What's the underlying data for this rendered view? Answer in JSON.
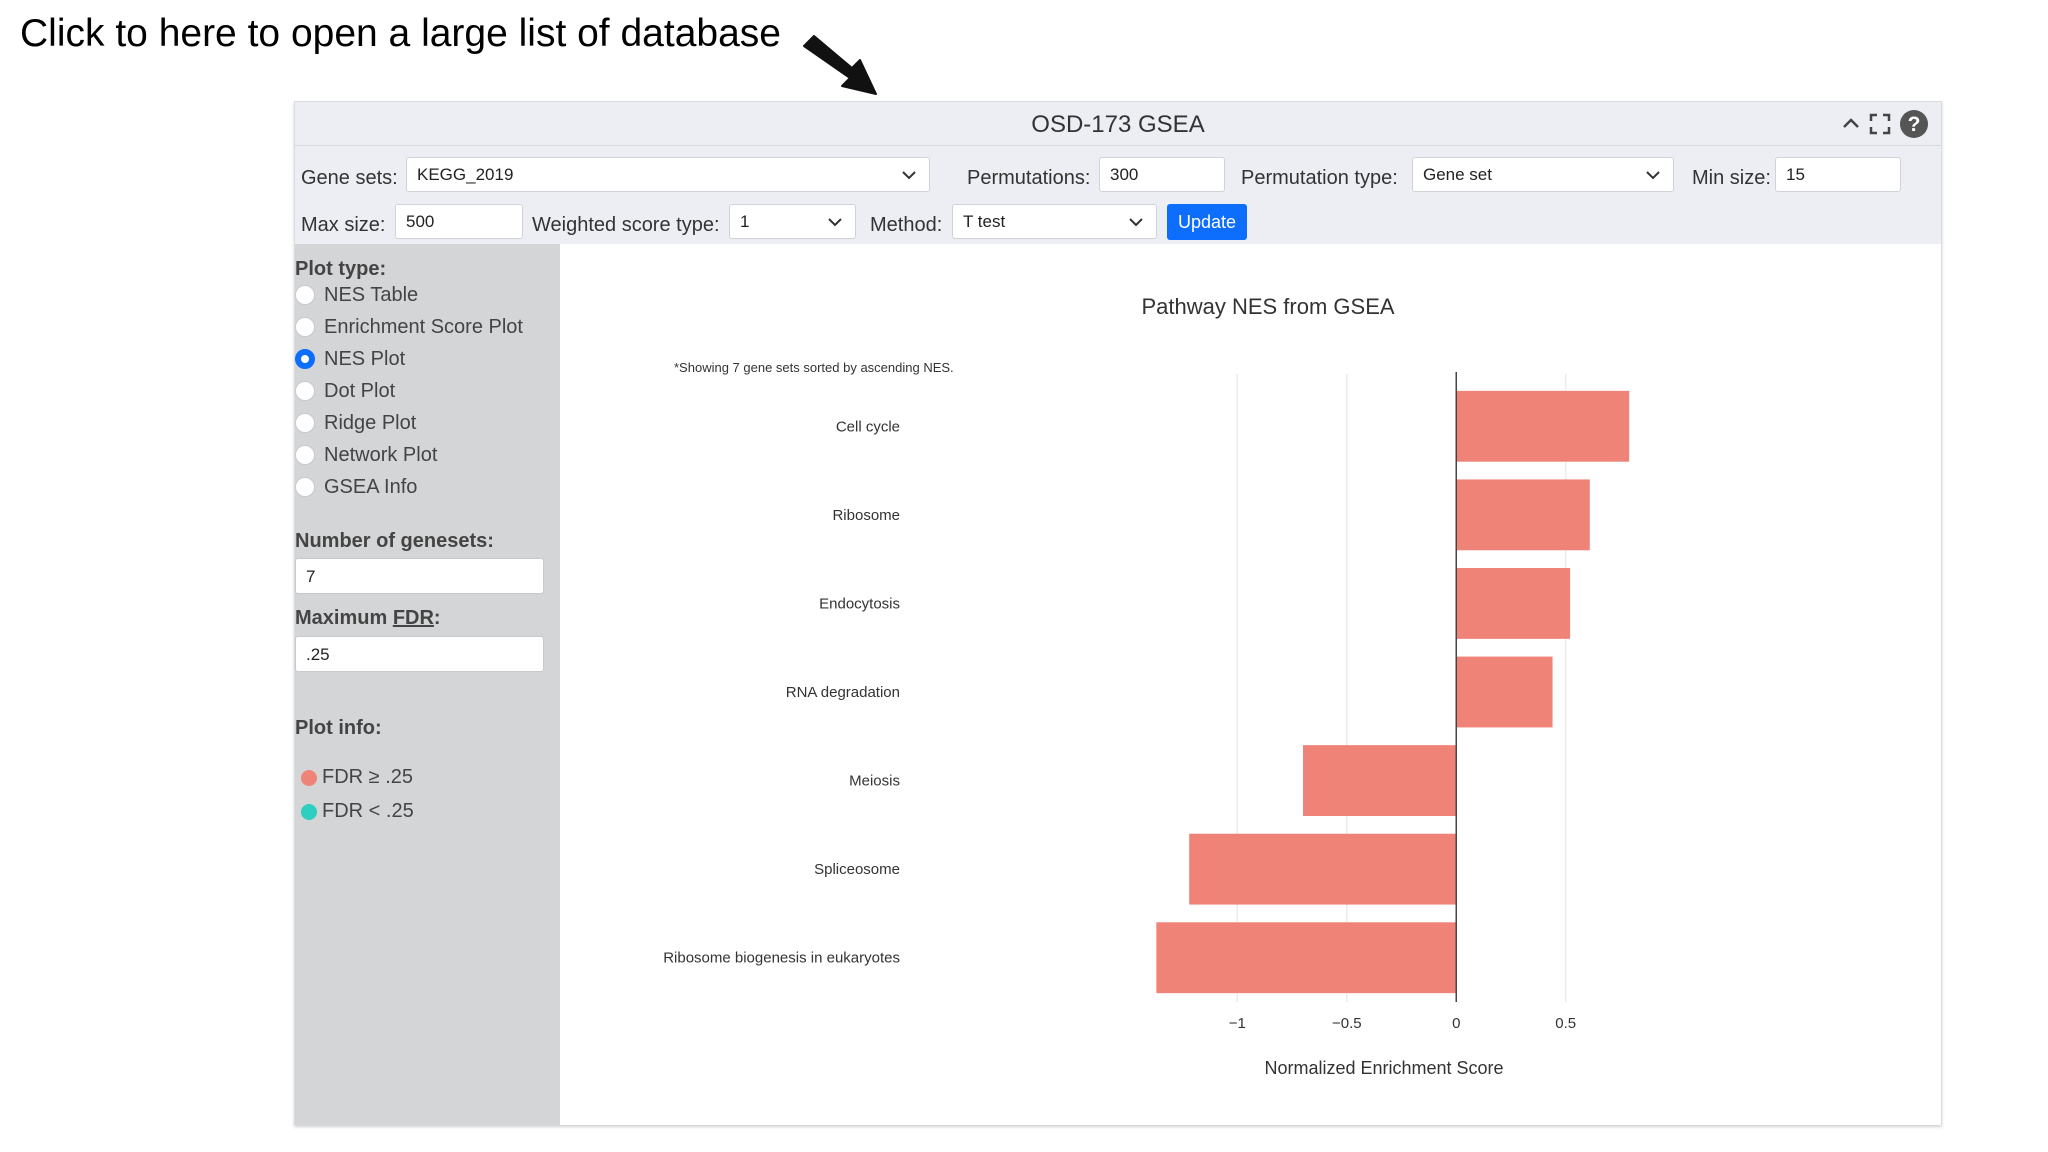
{
  "annotation": {
    "text": "Click to here to open a large list of database"
  },
  "panel": {
    "title": "OSD-173 GSEA",
    "icons": [
      "chevron-up-icon",
      "fullscreen-icon",
      "help-icon"
    ]
  },
  "controls": {
    "gene_sets_label": "Gene sets:",
    "gene_sets_value": "KEGG_2019",
    "permutations_label": "Permutations:",
    "permutations_value": "300",
    "permutation_type_label": "Permutation type:",
    "permutation_type_value": "Gene set",
    "min_size_label": "Min size:",
    "min_size_value": "15",
    "max_size_label": "Max size:",
    "max_size_value": "500",
    "weighted_label": "Weighted score type:",
    "weighted_value": "1",
    "method_label": "Method:",
    "method_value": "T test",
    "update_label": "Update"
  },
  "sidebar": {
    "plot_type_heading": "Plot type:",
    "plot_types": [
      {
        "label": "NES Table",
        "checked": false
      },
      {
        "label": "Enrichment Score Plot",
        "checked": false
      },
      {
        "label": "NES Plot",
        "checked": true
      },
      {
        "label": "Dot Plot",
        "checked": false
      },
      {
        "label": "Ridge Plot",
        "checked": false
      },
      {
        "label": "Network Plot",
        "checked": false
      },
      {
        "label": "GSEA Info",
        "checked": false
      }
    ],
    "num_genesets_label": "Number of genesets:",
    "num_genesets_value": "7",
    "max_fdr_prefix": "Maximum ",
    "max_fdr_abbr": "FDR",
    "max_fdr_suffix": ":",
    "max_fdr_value": ".25",
    "plot_info_heading": "Plot info:",
    "legend": [
      {
        "label": "FDR ≥ .25",
        "color": "#f08378"
      },
      {
        "label": "FDR < .25",
        "color": "#2ccfc0"
      }
    ]
  },
  "colors": {
    "accent": "#0d6efd",
    "bar": "#f08378",
    "panel_bg": "#eceef4",
    "sidebar_bg": "#d4d5d7"
  },
  "chart_data": {
    "type": "bar",
    "orientation": "horizontal",
    "title": "Pathway NES from GSEA",
    "note": "*Showing 7 gene sets sorted by ascending NES.",
    "xlabel": "Normalized Enrichment Score",
    "ylabel": "",
    "xlim": [
      -1.6,
      1.15
    ],
    "xticks": [
      -1,
      -0.5,
      0,
      0.5
    ],
    "xtick_labels": [
      "−1",
      "−0.5",
      "0",
      "0.5"
    ],
    "grid": true,
    "categories": [
      "Cell cycle",
      "Ribosome",
      "Endocytosis",
      "RNA degradation",
      "Meiosis",
      "Spliceosome",
      "Ribosome biogenesis in eukaryotes"
    ],
    "values": [
      0.79,
      0.61,
      0.52,
      0.44,
      -0.7,
      -1.22,
      -1.37
    ]
  }
}
